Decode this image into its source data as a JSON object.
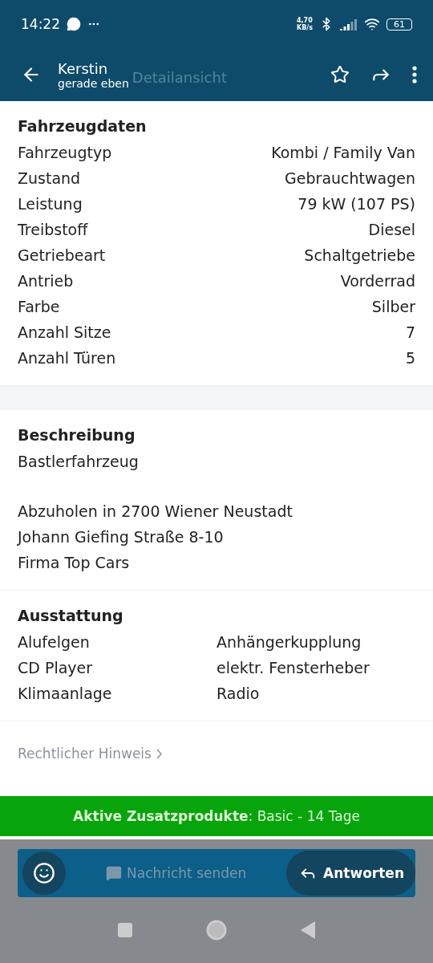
{
  "status_bar": {
    "time": "14:22",
    "speed": "4,70",
    "speed_unit": "KB/s",
    "battery": "61"
  },
  "header": {
    "name": "Kerstin",
    "subtitle": "gerade eben",
    "ghost_title": "Detailansicht"
  },
  "vehicle": {
    "title": "Fahrzeugdaten",
    "rows": [
      {
        "label": "Fahrzeugtyp",
        "value": "Kombi / Family Van"
      },
      {
        "label": "Zustand",
        "value": "Gebrauchtwagen"
      },
      {
        "label": "Leistung",
        "value": "79 kW (107 PS)"
      },
      {
        "label": "Treibstoff",
        "value": "Diesel"
      },
      {
        "label": "Getriebeart",
        "value": "Schaltgetriebe"
      },
      {
        "label": "Antrieb",
        "value": "Vorderrad"
      },
      {
        "label": "Farbe",
        "value": "Silber"
      },
      {
        "label": "Anzahl Sitze",
        "value": "7"
      },
      {
        "label": "Anzahl Türen",
        "value": "5"
      }
    ]
  },
  "description": {
    "title": "Beschreibung",
    "paragraphs": [
      [
        "Bastlerfahrzeug"
      ],
      [
        "Abzuholen in 2700 Wiener Neustadt",
        "Johann Giefing Straße 8-10",
        "Firma Top Cars"
      ]
    ]
  },
  "equipment": {
    "title": "Ausstattung",
    "items": [
      "Alufelgen",
      "Anhängerkupplung",
      "CD Player",
      "elektr. Fensterheber",
      "Klimaanlage",
      "Radio"
    ]
  },
  "legal_link": "Rechtlicher Hinweis",
  "promo_bar": "**Aktive Zusatzprodukte**: Basic - 14 Tage",
  "composer": {
    "placeholder": "Nachricht senden",
    "reply_button": "Antworten"
  }
}
